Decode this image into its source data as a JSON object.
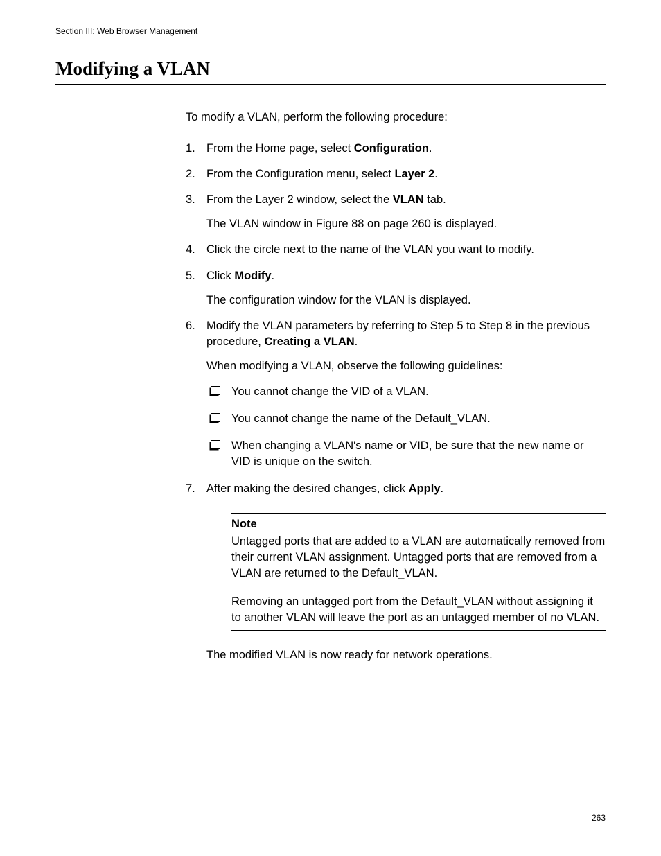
{
  "header": "Section III: Web Browser Management",
  "heading": "Modifying a VLAN",
  "intro": "To modify a VLAN, perform the following procedure:",
  "steps": {
    "s1": {
      "num": "1.",
      "pre": "From the Home page, select ",
      "bold": "Configuration",
      "post": "."
    },
    "s2": {
      "num": "2.",
      "pre": "From the Configuration menu, select ",
      "bold": "Layer 2",
      "post": "."
    },
    "s3": {
      "num": "3.",
      "pre": "From the Layer 2 window, select the ",
      "bold": "VLAN",
      "post": " tab.",
      "extra": "The VLAN window in Figure 88 on page 260 is displayed."
    },
    "s4": {
      "num": "4.",
      "text": "Click the circle next to the name of the VLAN you want to modify."
    },
    "s5": {
      "num": "5.",
      "pre": "Click ",
      "bold": "Modify",
      "post": ".",
      "extra": "The configuration window for the VLAN is displayed."
    },
    "s6": {
      "num": "6.",
      "pre": "Modify the VLAN parameters by referring to Step 5 to Step 8 in the previous procedure, ",
      "bold": "Creating a VLAN",
      "post": ".",
      "extra": "When modifying a VLAN, observe the following guidelines:"
    },
    "s7": {
      "num": "7.",
      "pre": "After making the desired changes, click ",
      "bold": "Apply",
      "post": "."
    }
  },
  "bullets": {
    "b1": "You cannot change the VID of a VLAN.",
    "b2": "You cannot change the name of the Default_VLAN.",
    "b3": "When changing a VLAN's name or VID, be sure that the new name or VID is unique on the switch."
  },
  "note": {
    "title": "Note",
    "p1": "Untagged ports that are added to a VLAN are automatically removed from their current VLAN assignment. Untagged ports that are removed from a VLAN are returned to the Default_VLAN.",
    "p2": "Removing an untagged port from the Default_VLAN without assigning it to another VLAN will leave the port as an untagged member of no VLAN."
  },
  "closing": "The modified VLAN is now ready for network operations.",
  "pageNumber": "263"
}
